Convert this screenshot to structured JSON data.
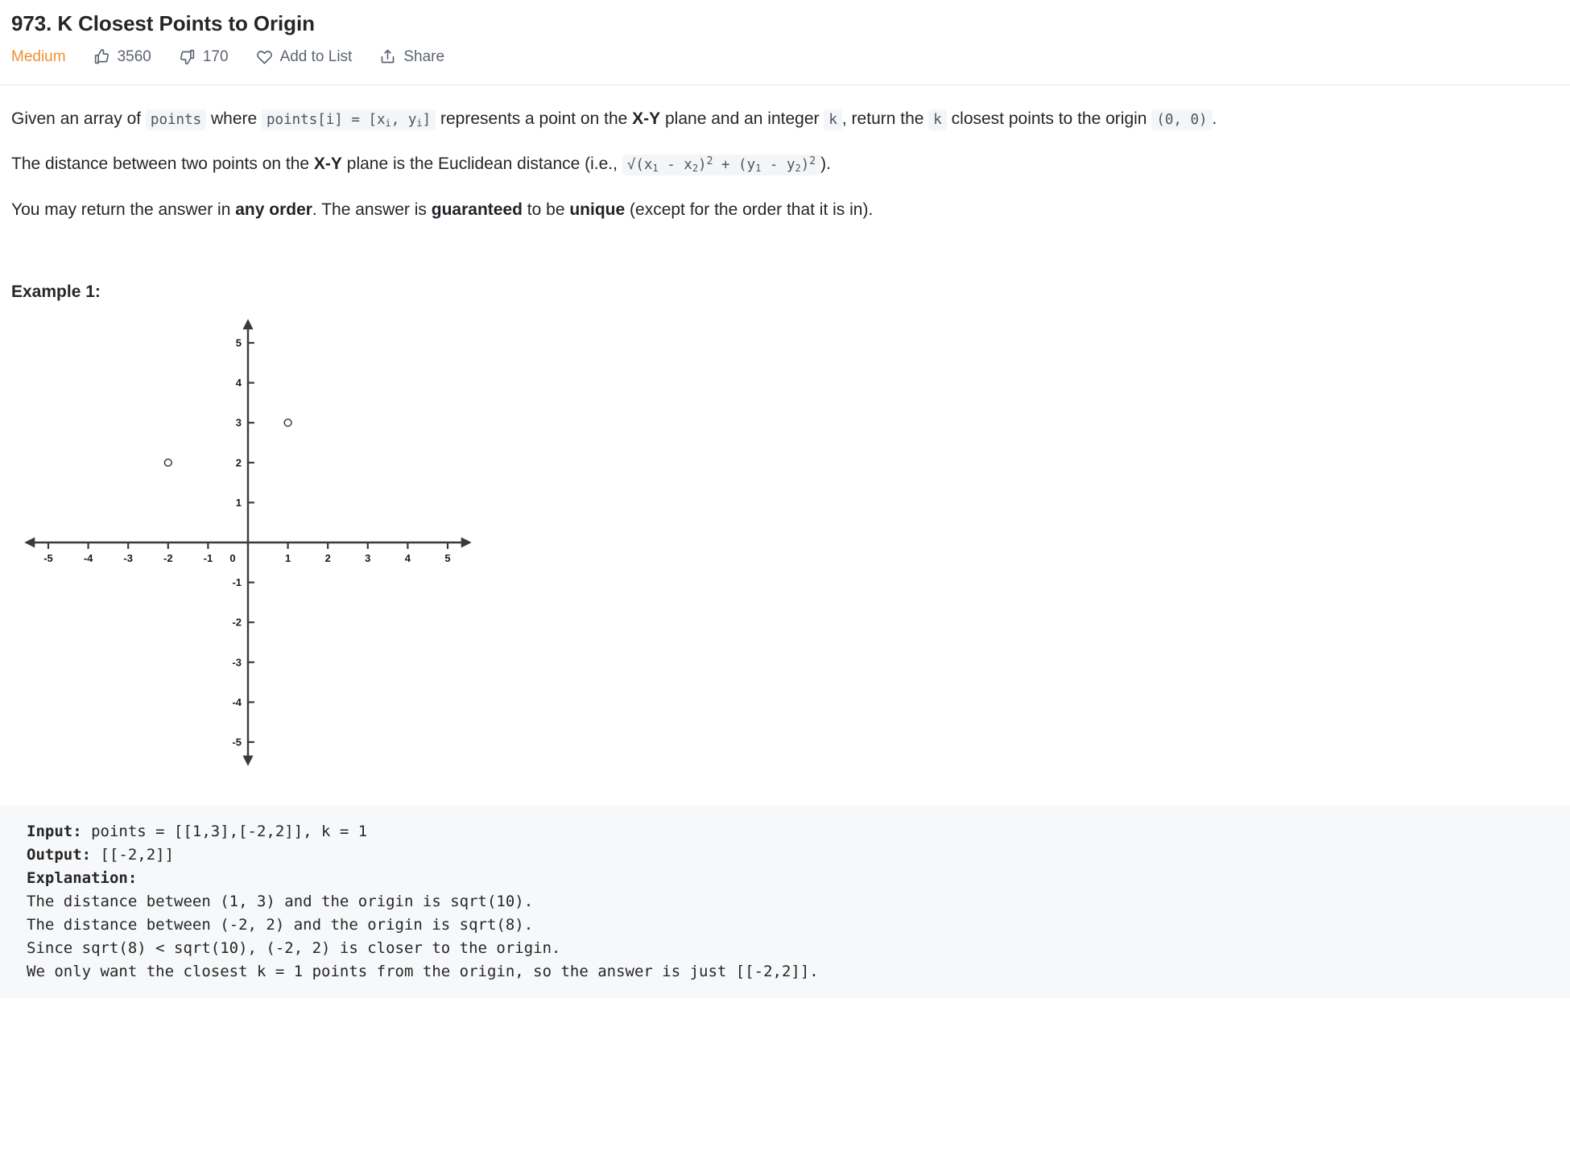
{
  "header": {
    "title": "973. K Closest Points to Origin",
    "difficulty": "Medium",
    "likes": "3560",
    "dislikes": "170",
    "add_to_list": "Add to List",
    "share": "Share",
    "difficulty_color": "#ef9031"
  },
  "description": {
    "p1_a": "Given an array of ",
    "p1_code1": "points",
    "p1_b": " where ",
    "p1_code2_pre": "points[i] = [x",
    "p1_code2_sub1": "i",
    "p1_code2_mid": ", y",
    "p1_code2_sub2": "i",
    "p1_code2_post": "]",
    "p1_c": " represents a point on the ",
    "p1_bold1": "X-Y",
    "p1_d": " plane and an integer ",
    "p1_code3": "k",
    "p1_e": ", return the ",
    "p1_code4": "k",
    "p1_f": " closest points to the origin ",
    "p1_code5": "(0, 0)",
    "p1_g": ".",
    "p2_a": "The distance between two points on the ",
    "p2_bold1": "X-Y",
    "p2_b": " plane is the Euclidean distance (i.e., ",
    "p2_code_a": "√(x",
    "p2_code_sub1": "1",
    "p2_code_b": " - x",
    "p2_code_sub2": "2",
    "p2_code_c": ")",
    "p2_code_sup1": "2",
    "p2_code_d": " + (y",
    "p2_code_sub3": "1",
    "p2_code_e": " - y",
    "p2_code_sub4": "2",
    "p2_code_f": ")",
    "p2_code_sup2": "2",
    "p2_c": ").",
    "p3_a": "You may return the answer in ",
    "p3_bold1": "any order",
    "p3_b": ". The answer is ",
    "p3_bold2": "guaranteed",
    "p3_c": " to be ",
    "p3_bold3": "unique",
    "p3_d": " (except for the order that it is in)."
  },
  "example": {
    "heading": "Example 1:",
    "input_label": "Input:",
    "input_value": " points = [[1,3],[-2,2]], k = 1",
    "output_label": "Output:",
    "output_value": " [[-2,2]]",
    "explanation_label": "Explanation:",
    "explanation_lines": [
      "The distance between (1, 3) and the origin is sqrt(10).",
      "The distance between (-2, 2) and the origin is sqrt(8).",
      "Since sqrt(8) < sqrt(10), (-2, 2) is closer to the origin.",
      "We only want the closest k = 1 points from the origin, so the answer is just [[-2,2]]."
    ]
  },
  "chart_data": {
    "type": "scatter",
    "title": "",
    "xlabel": "",
    "ylabel": "",
    "xlim": [
      -5.6,
      5.6
    ],
    "ylim": [
      -5.6,
      5.6
    ],
    "grid": false,
    "legend": null,
    "x_ticks": [
      -5,
      -4,
      -3,
      -2,
      -1,
      0,
      1,
      2,
      3,
      4,
      5
    ],
    "x_tick_labels": [
      "-5",
      "-4",
      "-3",
      "-2",
      "-1",
      "0",
      "1",
      "2",
      "3",
      "4",
      "5"
    ],
    "y_ticks": [
      5,
      4,
      3,
      2,
      1,
      -1,
      -2,
      -3,
      -4,
      -5
    ],
    "y_tick_labels": [
      "5",
      "4",
      "3",
      "2",
      "1",
      "-1",
      "-2",
      "-3",
      "-4",
      "-5"
    ],
    "points": [
      {
        "x": 1,
        "y": 3,
        "label": "(1, 3)"
      },
      {
        "x": -2,
        "y": 2,
        "label": "(-2, 2)"
      }
    ],
    "marker": "open-circle",
    "axis_color": "#3a3a3a",
    "point_color": "#2b2b2b"
  }
}
